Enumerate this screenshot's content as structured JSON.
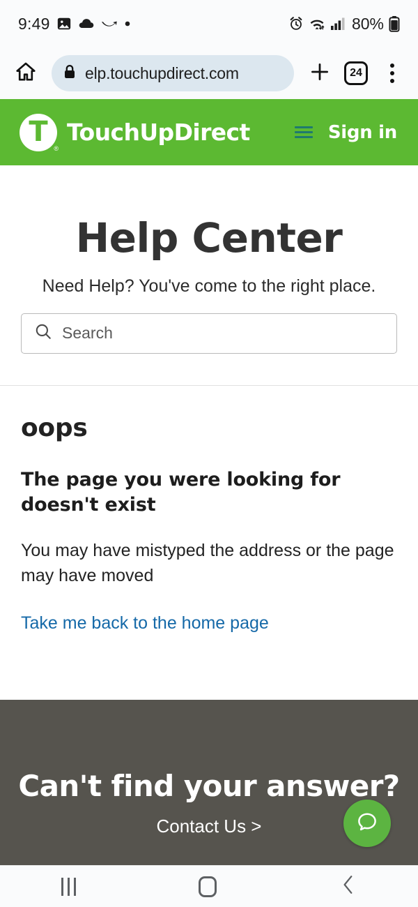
{
  "status_bar": {
    "time": "9:49",
    "battery_percent": "80%",
    "left_icons": [
      "image-icon",
      "cloud-icon",
      "swoosh-icon",
      "dot-icon"
    ],
    "right_icons": [
      "alarm-icon",
      "wifi-icon",
      "signal-icon",
      "battery-icon"
    ]
  },
  "browser": {
    "home_icon": "home-icon",
    "lock_icon": "lock-icon",
    "url": "elp.touchupdirect.com",
    "new_tab_label": "+",
    "tab_count": "24",
    "menu_icon": "kebab-menu-icon"
  },
  "site_header": {
    "logo_letter": "T",
    "logo_registered": "®",
    "brand_name": "TouchUpDirect",
    "menu_icon": "hamburger-icon",
    "sign_in_label": "Sign in",
    "background_color": "#5cb932",
    "menu_icon_color": "#1f7a6e"
  },
  "hero": {
    "title": "Help Center",
    "subtitle": "Need Help? You've come to the right place.",
    "search_placeholder": "Search",
    "search_value": "",
    "search_icon": "search-icon"
  },
  "error": {
    "heading": "oops",
    "subheading": "The page you were looking for doesn't exist",
    "body": "You may have mistyped the address or the page may have moved",
    "link_label": "Take me back to the home page",
    "link_color": "#1569a8"
  },
  "footer": {
    "heading": "Can't find your answer?",
    "contact_label": "Contact Us >",
    "background_color": "#56544e",
    "chat_icon": "chat-bubble-icon",
    "chat_button_color": "#5cb441"
  },
  "nav_bar": {
    "recent_label": "recent-apps",
    "home_label": "home",
    "back_label": "back"
  }
}
